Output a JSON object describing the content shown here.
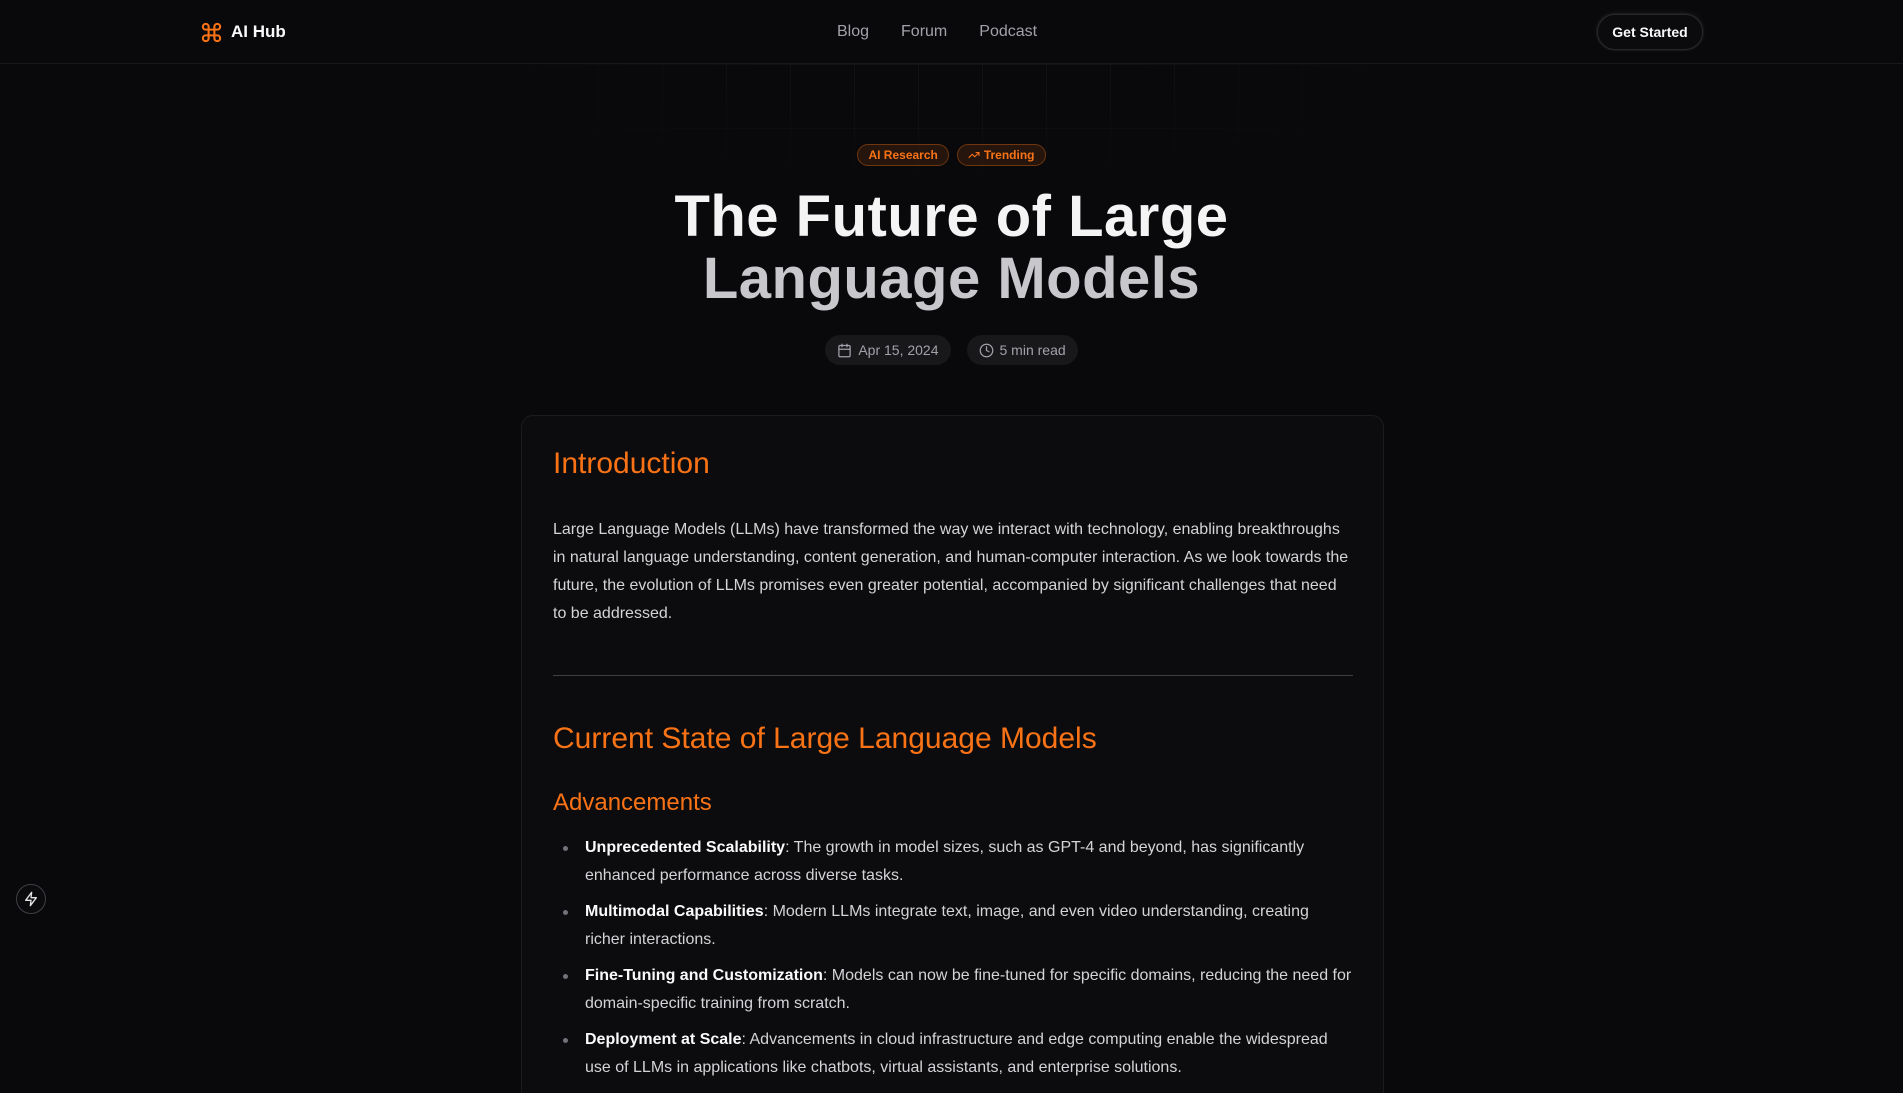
{
  "header": {
    "logo_text": "AI Hub",
    "nav": [
      {
        "label": "Blog"
      },
      {
        "label": "Forum"
      },
      {
        "label": "Podcast"
      }
    ],
    "cta_label": "Get Started"
  },
  "article": {
    "badges": [
      {
        "label": "AI Research",
        "icon": ""
      },
      {
        "label": "Trending",
        "icon": "trending-up-icon"
      }
    ],
    "title_line1": "The Future of Large",
    "title_line2": "Language Models",
    "date": "Apr 15, 2024",
    "read_time": "5 min read",
    "intro_heading": "Introduction",
    "intro_text": "Large Language Models (LLMs) have transformed the way we interact with technology, enabling breakthroughs in natural language understanding, content generation, and human-computer interaction. As we look towards the future, the evolution of LLMs promises even greater potential, accompanied by significant challenges that need to be addressed.",
    "section_heading": "Current State of Large Language Models",
    "subsection_heading": "Advancements",
    "advancements": [
      {
        "term": "Unprecedented Scalability",
        "text": ": The growth in model sizes, such as GPT-4 and beyond, has significantly enhanced performance across diverse tasks."
      },
      {
        "term": "Multimodal Capabilities",
        "text": ": Modern LLMs integrate text, image, and even video understanding, creating richer interactions."
      },
      {
        "term": "Fine-Tuning and Customization",
        "text": ": Models can now be fine-tuned for specific domains, reducing the need for domain-specific training from scratch."
      },
      {
        "term": "Deployment at Scale",
        "text": ": Advancements in cloud infrastructure and edge computing enable the widespread use of LLMs in applications like chatbots, virtual assistants, and enterprise solutions."
      }
    ]
  },
  "colors": {
    "accent": "#f97316",
    "background": "#09090b",
    "card": "#0c0c0e"
  },
  "icons": {
    "logo": "command-icon",
    "date": "calendar-icon",
    "read_time": "clock-icon",
    "side_button": "lightning-icon"
  }
}
